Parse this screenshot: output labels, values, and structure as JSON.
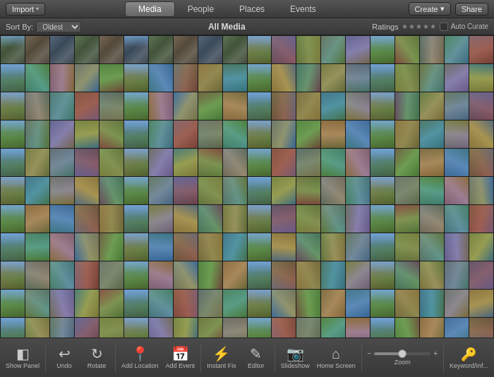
{
  "topNav": {
    "import_label": "Import",
    "tabs": [
      {
        "id": "media",
        "label": "Media",
        "active": true
      },
      {
        "id": "people",
        "label": "People",
        "active": false
      },
      {
        "id": "places",
        "label": "Places",
        "active": false
      },
      {
        "id": "events",
        "label": "Events",
        "active": false
      }
    ],
    "create_label": "Create",
    "share_label": "Share"
  },
  "toolbar": {
    "sort_by_label": "Sort By:",
    "sort_option": "Oldest",
    "title": "All Media",
    "ratings_label": "Ratings",
    "auto_curate_label": "Auto Curate"
  },
  "bottomToolbar": {
    "tools": [
      {
        "id": "show-panel",
        "icon": "◧",
        "label": "Show Panel"
      },
      {
        "id": "undo",
        "icon": "↩",
        "label": "Undo"
      },
      {
        "id": "rotate",
        "icon": "↻",
        "label": "Rotate"
      },
      {
        "id": "add-location",
        "icon": "📍",
        "label": "Add Location"
      },
      {
        "id": "add-event",
        "icon": "📅",
        "label": "Add Event"
      },
      {
        "id": "instant-fix",
        "icon": "⚡",
        "label": "Instant Fix"
      },
      {
        "id": "editor",
        "icon": "✏️",
        "label": "Editor"
      },
      {
        "id": "slideshow",
        "icon": "📷",
        "label": "Slideshow"
      },
      {
        "id": "home-screen",
        "icon": "🏠",
        "label": "Home Screen"
      }
    ],
    "zoom_label": "Zoom",
    "keyword_label": "Keyword/Inf..."
  },
  "photoCount": 220
}
